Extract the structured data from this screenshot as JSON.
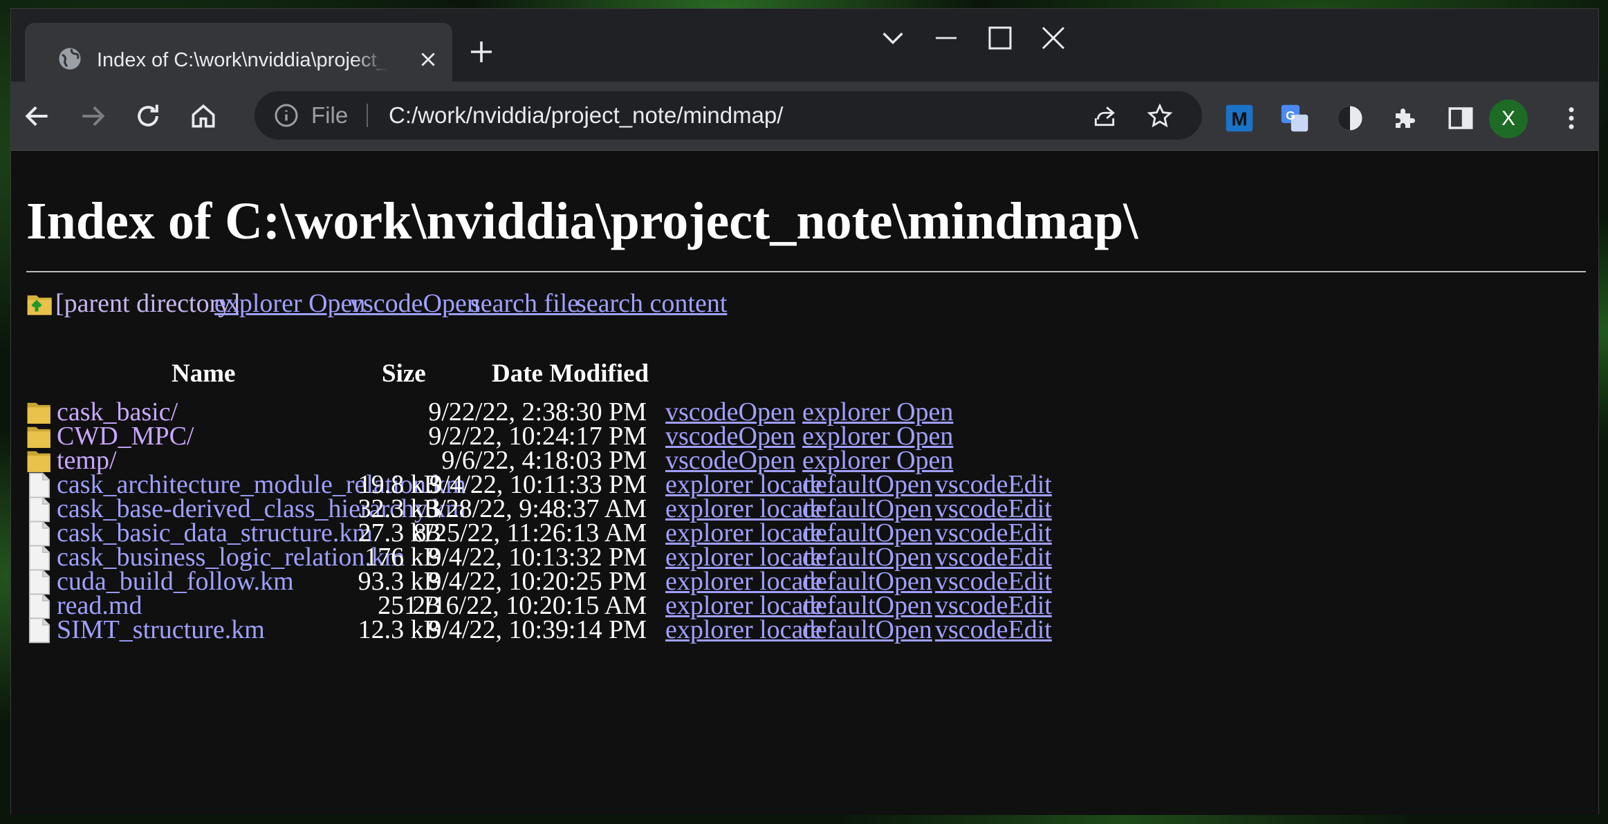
{
  "browser": {
    "tab_title": "Index of C:\\work\\nviddia\\project_note\\mindmap\\",
    "omnibox_scheme": "File",
    "url": "C:/work/nviddia/project_note/mindmap/",
    "profile_initial": "X"
  },
  "page": {
    "heading": "Index of C:\\work\\nviddia\\project_note\\mindmap\\",
    "parent_link": "[parent directory]",
    "top_links": [
      "explorer Open",
      "vscodeOpen ",
      "search file ",
      "search content"
    ],
    "columns": {
      "name": "Name",
      "size": "Size",
      "date": "Date Modified"
    },
    "rows": [
      {
        "type": "folder",
        "name": "cask_basic/",
        "size": "",
        "date": "9/22/22, 2:38:30 PM",
        "a1": "vscodeOpen",
        "a2": "explorer Open",
        "a3": ""
      },
      {
        "type": "folder",
        "name": "CWD_MPC/",
        "size": "",
        "date": "9/2/22, 10:24:17 PM",
        "a1": "vscodeOpen",
        "a2": "explorer Open",
        "a3": ""
      },
      {
        "type": "folder",
        "name": "temp/",
        "size": "",
        "date": "9/6/22, 4:18:03 PM",
        "a1": "vscodeOpen",
        "a2": "explorer Open",
        "a3": ""
      },
      {
        "type": "file",
        "name": "cask_architecture_module_relation.km",
        "size": "19.8 kB",
        "date": "9/4/22, 10:11:33 PM",
        "a1": "explorer locate",
        "a2": "defaultOpen",
        "a3": "vscodeEdit"
      },
      {
        "type": "file",
        "name": "cask_base-derived_class_hierarchy.km",
        "size": "32.3 kB",
        "date": "3/28/22, 9:48:37 AM",
        "a1": "explorer locate",
        "a2": "defaultOpen",
        "a3": "vscodeEdit"
      },
      {
        "type": "file",
        "name": "cask_basic_data_structure.km",
        "size": "27.3 kB",
        "date": "8/25/22, 11:26:13 AM",
        "a1": "explorer locate",
        "a2": "defaultOpen",
        "a3": "vscodeEdit"
      },
      {
        "type": "file",
        "name": "cask_business_logic_relation.km",
        "size": "176 kB",
        "date": "9/4/22, 10:13:32 PM",
        "a1": "explorer locate",
        "a2": "defaultOpen",
        "a3": "vscodeEdit"
      },
      {
        "type": "file",
        "name": "cuda_build_follow.km",
        "size": "93.3 kB",
        "date": "9/4/22, 10:20:25 PM",
        "a1": "explorer locate",
        "a2": "defaultOpen",
        "a3": "vscodeEdit"
      },
      {
        "type": "file",
        "name": "read.md",
        "size": "251 B",
        "date": "2/16/22, 10:20:15 AM",
        "a1": "explorer locate",
        "a2": "defaultOpen",
        "a3": "vscodeEdit"
      },
      {
        "type": "file",
        "name": "SIMT_structure.km",
        "size": "12.3 kB",
        "date": "9/4/22, 10:39:14 PM",
        "a1": "explorer locate",
        "a2": "defaultOpen",
        "a3": "vscodeEdit"
      }
    ]
  },
  "colors": {
    "link": "#a0a0ff",
    "visited": "#c9a8ff",
    "background": "#101010",
    "folder": "#e8c24a"
  },
  "icons": [
    "globe-icon",
    "close-icon",
    "plus-icon",
    "chevron-down-icon",
    "minimize-icon",
    "maximize-icon",
    "back-icon",
    "forward-icon",
    "reload-icon",
    "home-icon",
    "info-icon",
    "share-icon",
    "star-icon",
    "extension-m-icon",
    "translate-icon",
    "contrast-icon",
    "puzzle-icon",
    "side-panel-icon",
    "menu-icon",
    "folder-up-icon",
    "folder-icon",
    "file-icon"
  ]
}
